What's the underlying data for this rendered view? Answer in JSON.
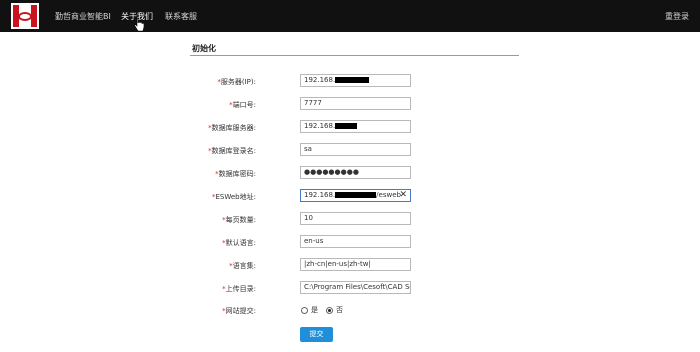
{
  "navbar": {
    "links": [
      "勤哲商业智能BI",
      "关于我们",
      "联系客服"
    ],
    "active_index": 1,
    "right_link": "重登录",
    "logo_icon": "cad-logo-icon",
    "brand_color": "#c8141e"
  },
  "form": {
    "title": "初始化",
    "required_mark": "*",
    "fields": [
      {
        "label": "服务器(IP):",
        "value": "192.168.",
        "redacted": true
      },
      {
        "label": "端口号:",
        "value": "7777"
      },
      {
        "label": "数据库服务器:",
        "value": "192.168.",
        "redacted": true
      },
      {
        "label": "数据库登录名:",
        "value": "sa"
      },
      {
        "label": "数据库密码:",
        "value": "●●●●●●●●●"
      },
      {
        "label": "ESWeb地址:",
        "value_prefix": "192.168.",
        "value_suffix": "/esweb",
        "focused": true,
        "clear_icon": "✕"
      },
      {
        "label": "每页数量:",
        "value": "10"
      },
      {
        "label": "默认语言:",
        "value": "en-us"
      },
      {
        "label": "语言集:",
        "value": "|zh-cn|en-us|zh-tw|"
      },
      {
        "label": "上传目录:",
        "value": "C:\\Program Files\\Cesoft\\CAD Serve"
      }
    ],
    "site_submit": {
      "label": "网站提交:",
      "options": [
        "是",
        "否"
      ],
      "selected": "否"
    },
    "submit_label": "提交",
    "accent_color": "#1e8fd8"
  }
}
